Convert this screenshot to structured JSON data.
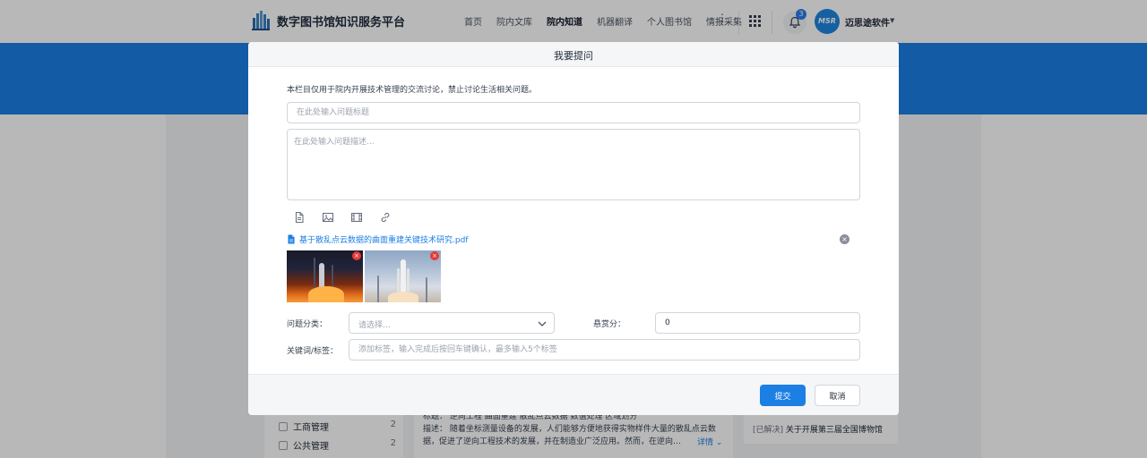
{
  "app": {
    "brand": "数字图书馆知识服务平台",
    "logo_icon": "building-columns-icon"
  },
  "nav": {
    "items": [
      "首页",
      "院内文库",
      "院内知道",
      "机器翻译",
      "个人图书馆",
      "情报采集"
    ],
    "active": "院内知道",
    "more_icon": "vertical-dots-icon",
    "more_glyph": "⋮"
  },
  "header": {
    "apps_icon": "grid-icon",
    "notification_icon": "bell-icon",
    "notification_count": "3",
    "avatar_text": "MSR",
    "user_name": "迈思途软件",
    "caret": "▼"
  },
  "background": {
    "categories": [
      {
        "label": "工商管理",
        "count": "2"
      },
      {
        "label": "公共管理",
        "count": "2"
      }
    ],
    "result_keywords": "标题：  逆向工程  曲面重建  散乱点云数据  数值处理  区域划分",
    "result_desc": "描述：    随着坐标测量设备的发展，人们能够方便地获得实物样件大量的散乱点云数据，促进了逆向工程技术的发展，并在制造业广泛应用。然而，在逆向…",
    "result_detail": "详情 ⌄",
    "news_tag": "[已解决]",
    "news_title": "关于开展第三届全国博物馆"
  },
  "modal": {
    "title": "我要提问",
    "notice": "本栏目仅用于院内开展技术管理的交流讨论，禁止讨论生活相关问题。",
    "title_placeholder": "在此处输入问题标题",
    "desc_placeholder": "在此处输入问题描述...",
    "toolbar": {
      "file_icon": "file-icon",
      "image_icon": "image-icon",
      "video_icon": "film-icon",
      "link_icon": "link-icon"
    },
    "attachment": {
      "name": "基于散乱点云数据的曲面重建关键技术研究.pdf",
      "icon": "pdf-file-icon",
      "remove_glyph": "×"
    },
    "images": [
      {
        "name": "rocket-launch-night"
      },
      {
        "name": "rocket-launch-day"
      }
    ],
    "category_label": "问题分类：",
    "category_placeholder": "请选择...",
    "reward_label": "悬赏分：",
    "reward_value": "0",
    "tags_label": "关键词/标签：",
    "tags_placeholder": "添加标签，输入完成后按回车键确认，最多输入5个标签",
    "submit_label": "提交",
    "cancel_label": "取消"
  }
}
